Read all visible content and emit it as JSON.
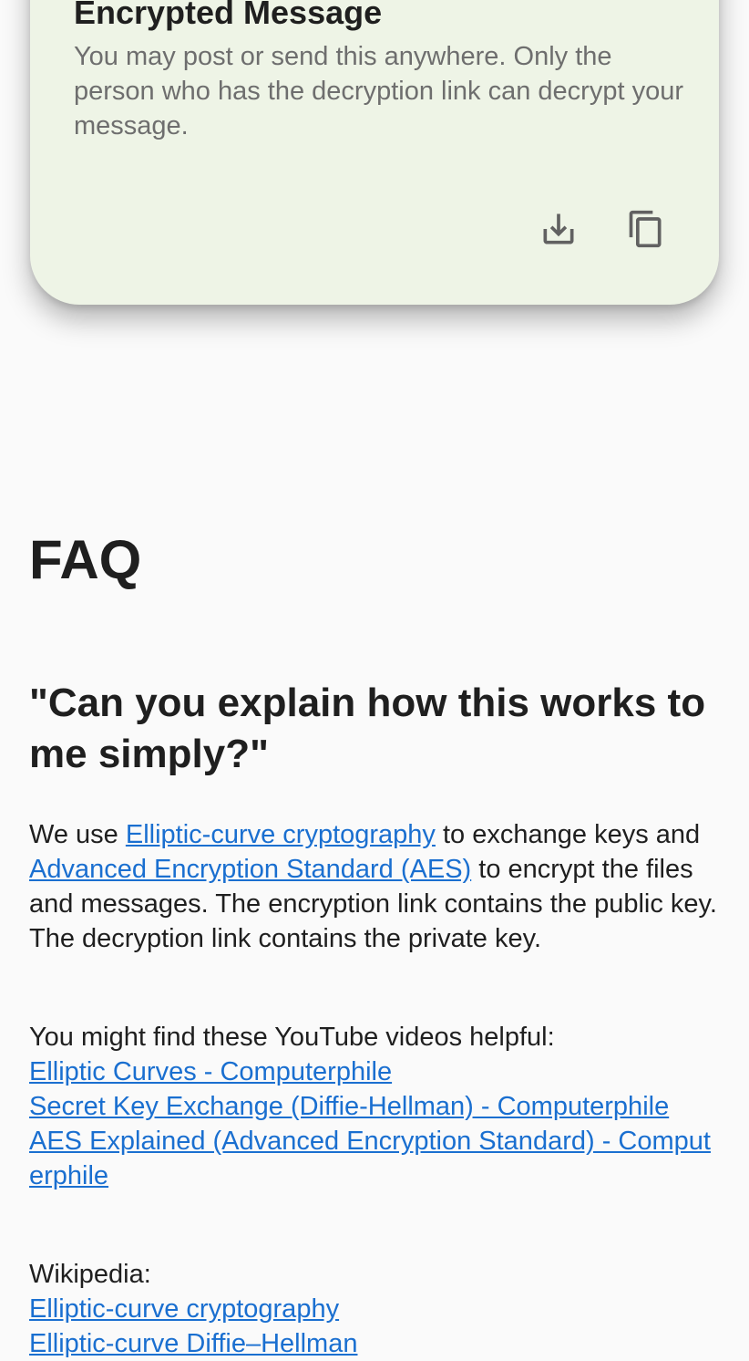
{
  "card": {
    "title": "Encrypted Message",
    "description": "You may post or send this anywhere. Only the person who has the decryption link can decrypt your message.",
    "actions": [
      {
        "icon": "download-icon"
      },
      {
        "icon": "copy-icon"
      }
    ]
  },
  "faq": {
    "title": "FAQ",
    "question": "\"Can you explain how this works to me simply?\"",
    "answer": {
      "t1": "We use ",
      "link_ecc": "Elliptic-curve cryptography",
      "t2": " to exchange keys and ",
      "link_aes": "Advanced Encryption Standard (AES)",
      "t3": " to encrypt the files and messages. The encryption link contains the public key. The decryption link contains the private key."
    },
    "videos_intro": "You might find these YouTube videos helpful:",
    "videos": [
      "Elliptic Curves - Computerphile",
      "Secret Key Exchange (Diffie-Hellman) - Computerphile",
      "AES Explained (Advanced Encryption Standard) - Computerphile"
    ],
    "wikipedia_intro": "Wikipedia:",
    "wikipedia_links": [
      "Elliptic-curve cryptography",
      "Elliptic-curve Diffie–Hellman"
    ]
  }
}
